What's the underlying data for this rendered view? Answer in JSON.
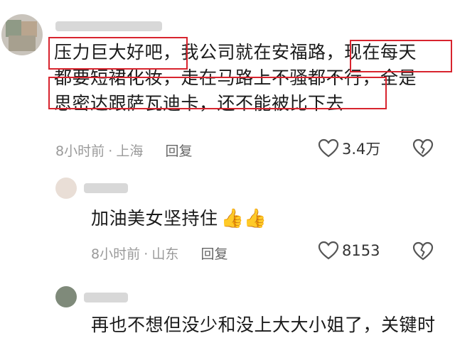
{
  "comments": [
    {
      "lines": [
        "压力巨大好吧，我公司就在安福路，现在每天",
        "都要短裙化妆，走在马路上不骚都不行，全是",
        "思密达跟萨瓦迪卡，还不能被比下去"
      ],
      "time": "8小时前",
      "location": "上海",
      "reply": "回复",
      "likes": "3.4万"
    },
    {
      "text": "加油美女坚持住",
      "emoji": "👍👍",
      "time": "8小时前",
      "location": "山东",
      "reply": "回复",
      "likes": "8153"
    },
    {
      "partial_text": "再也不想但没少和没上大大小姐了，关键时"
    }
  ],
  "separator": "·",
  "colors": {
    "highlight": "#d8242e",
    "meta": "#9a9a9a"
  },
  "icons": [
    "heart-outline-icon",
    "broken-heart-icon",
    "thumbs-up-emoji"
  ]
}
